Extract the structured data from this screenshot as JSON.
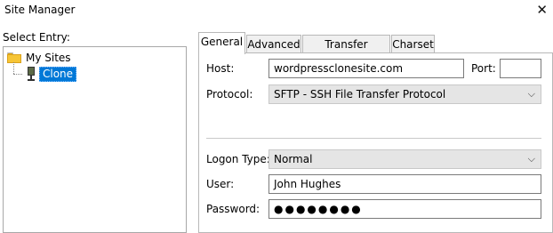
{
  "window": {
    "title": "Site Manager",
    "close_glyph": "✕"
  },
  "left": {
    "label": "Select Entry:",
    "tree": {
      "root": "My Sites",
      "child": "Clone"
    }
  },
  "tabs": [
    "General",
    "Advanced",
    "Transfer Settings",
    "Charset"
  ],
  "general": {
    "host_label": "Host:",
    "host_value": "wordpressclonesite.com",
    "port_label": "Port:",
    "port_value": "",
    "protocol_label": "Protocol:",
    "protocol_value": "SFTP - SSH File Transfer Protocol",
    "logon_label": "Logon Type:",
    "logon_value": "Normal",
    "user_label": "User:",
    "user_value": "John Hughes",
    "password_label": "Password:",
    "password_value": "●●●●●●●●"
  },
  "icons": {
    "folder": "folder-icon",
    "server": "server-icon",
    "dropdown": "chevron-down-icon"
  }
}
